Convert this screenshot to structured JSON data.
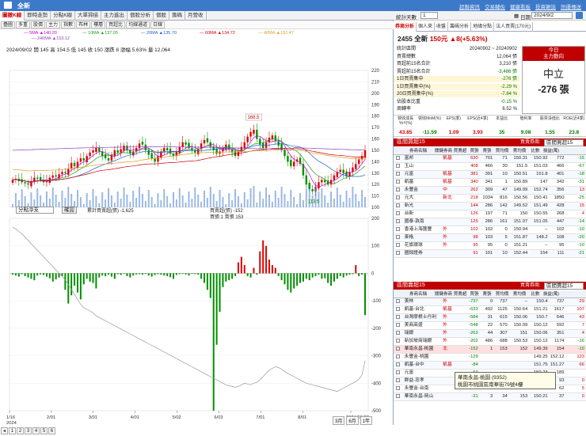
{
  "window": {
    "title": "全新",
    "links": [
      "超聯資訊",
      "交易輔佐",
      "健康看板",
      "投資雜誌",
      "訊優傳送"
    ]
  },
  "left_tabs": [
    "圖撤K線",
    "即時走勢",
    "分點K線",
    "大單掃描",
    "主力進出",
    "個股分析",
    "個股",
    "籌碼",
    "月營收"
  ],
  "left_tabs_active": 0,
  "toolbar": [
    "疊圖",
    "多重",
    "股價",
    "主力",
    "指數",
    "布林",
    "樓層",
    "買超比",
    "均線通道",
    "日線"
  ],
  "ma_legend": [
    {
      "label": "5MA",
      "value": "140.20",
      "color": "#d000d0"
    },
    {
      "label": "10MA",
      "value": "137.05",
      "color": "#20a020"
    },
    {
      "label": "20MA",
      "value": "135.70",
      "color": "#2060d0"
    },
    {
      "label": "60MA",
      "value": "134.72",
      "color": "#d00000"
    },
    {
      "label": "40MA",
      "value": "152.47",
      "color": "#e0a020"
    },
    {
      "label": "240MA",
      "value": "153.12",
      "color": "#9040c0"
    }
  ],
  "ohlc_line": "2024/09/02  開 145  高 154.5  低 145  收 150  漲跌 8  漲幅 5.63%  量 12,064",
  "highlight_labels": {
    "high": "168.5",
    "low": "113.5"
  },
  "price_axis": [
    "220",
    "210",
    "200",
    "190",
    "180",
    "170",
    "160",
    "150",
    "140",
    "130",
    "120",
    "110",
    "100"
  ],
  "sub_controls": {
    "select": "分點淨支",
    "button": "確認"
  },
  "sub_legend": [
    "累計買賣超(張) -1,625",
    "買賣超(張) -152",
    "買張:1 賣張 153"
  ],
  "sub_axis": [
    "200",
    "100",
    "0",
    "-100",
    "-200",
    "-300",
    "-400",
    "-500"
  ],
  "date_axis": [
    "1/16\n2024",
    "2/01",
    "3/01",
    "4/01",
    "5/02",
    "6/03",
    "7/01",
    "8/01",
    "2024/09/02"
  ],
  "range_buttons": [
    "3月",
    "6月",
    "1年"
  ],
  "pager": [
    "1",
    "2",
    "3",
    "4",
    "5",
    "6"
  ],
  "right_top": {
    "label": "統計天數",
    "days": "1",
    "date_label": "日期",
    "date": "2024/9/2"
  },
  "right_tabs": [
    "券商分析",
    "個人來",
    "收盤",
    "籌碼分析",
    "地緣分點",
    "法人買賣(170元)"
  ],
  "stock": {
    "code": "2455",
    "name": "全新",
    "price": "150元",
    "change": "▲8(+5.63%)"
  },
  "stats": [
    {
      "k": "統計區間",
      "v": "20240902 ~ 20240902"
    },
    {
      "k": "買賣總數",
      "v": "12,064 張"
    },
    {
      "k": "買超前15名合計",
      "v": "3,210 張"
    },
    {
      "k": "賣超前15名合計",
      "v": "-3,486 張"
    },
    {
      "k": "1日買賣集中",
      "v": "-276 張"
    },
    {
      "k": "1日買賣集中(%)",
      "v": "-2.29 %"
    },
    {
      "k": "20日買賣集中(%)",
      "v": "-7.84 %"
    },
    {
      "k": "佔股本比重",
      "v": "-0.15 %"
    },
    {
      "k": "周轉率",
      "v": "6.52 %"
    }
  ],
  "market": {
    "title1": "今日",
    "title2": "主力動向",
    "state": "中立",
    "value": "-276 張"
  },
  "fund_head": [
    "營收成長YoY(%)",
    "營收MoM(%)",
    "EPS(季)",
    "EPS(近4季)",
    "本益比",
    "殖利率",
    "股票淨值比",
    "ROE(近4季)"
  ],
  "fund_vals": [
    "43.85",
    "-11.59",
    "1.09",
    "3.93",
    "35",
    "9.08",
    "1.55",
    "23.8"
  ],
  "buy_section": {
    "title": "區間買超15",
    "filter_label": "買賣券商:",
    "filter_value": "區間買超15"
  },
  "sell_section": {
    "title": "區間賣超15",
    "filter_label": "買賣券商:",
    "filter_value": "區間賣超15"
  },
  "table_cols": [
    "",
    "券商名稱",
    "關鍵券商",
    "買賣超",
    "買張",
    "賣張",
    "買均價",
    "賣均價",
    "比數",
    "損益(萬)"
  ],
  "buy_rows": [
    [
      "富邦",
      "凱基",
      "630",
      "701",
      "71",
      "150.31",
      "150.92",
      "772",
      "-15"
    ],
    [
      "玉山",
      "",
      "408",
      "466",
      "30",
      "151.5",
      "151.03",
      "466",
      "-67"
    ],
    [
      "元富",
      "凱基",
      "381",
      "391",
      "10",
      "150.51",
      "151.8",
      "401",
      "-18"
    ],
    [
      "凱基",
      "凱基",
      "340",
      "341",
      "1",
      "150.89",
      "147",
      "342",
      "-31"
    ],
    [
      "永豐金",
      "中",
      "262",
      "309",
      "47",
      "149.99",
      "152.74",
      "356",
      "13"
    ],
    [
      "元大",
      "新北",
      "218",
      "1034",
      "816",
      "150.56",
      "150.41",
      "1850",
      "-25"
    ],
    [
      "新光",
      "",
      "144",
      "286",
      "142",
      "149.52",
      "151.49",
      "428",
      "15"
    ],
    [
      "台新",
      "",
      "126",
      "197",
      "71",
      "150",
      "150.55",
      "268",
      "4"
    ],
    [
      "國泰-敦南",
      "",
      "125",
      "286",
      "161",
      "151.07",
      "151.05",
      "447",
      "-14"
    ],
    [
      "香港上海匯豐",
      "外",
      "102",
      "102",
      "0",
      "150.94",
      "--",
      "102",
      "-10"
    ],
    [
      "麥格",
      "外",
      "98",
      "103",
      "5",
      "151.87",
      "148.2",
      "108",
      "-20"
    ],
    [
      "花旗環球",
      "外",
      "95",
      "95",
      "0",
      "151.21",
      "--",
      "95",
      "-10"
    ],
    [
      "國錢證券",
      "",
      "91",
      "101",
      "10",
      "152.44",
      "154",
      "111",
      "-21"
    ]
  ],
  "sell_rows": [
    [
      "美林",
      "外",
      "-737",
      "0",
      "737",
      "--",
      "150.4",
      "737",
      "29"
    ],
    [
      "凱基-台北",
      "凱基",
      "-633",
      "492",
      "1125",
      "150.64",
      "151.21",
      "1617",
      "107"
    ],
    [
      "台灣摩根士丹利",
      "外",
      "-584",
      "31",
      "615",
      "150.06",
      "150.7",
      "646",
      "43"
    ],
    [
      "美商高盛",
      "外",
      "-548",
      "22",
      "570",
      "150.09",
      "150.12",
      "592",
      "7"
    ],
    [
      "瑞銀",
      "外",
      "-263",
      "44",
      "307",
      "151",
      "150.06",
      "351",
      "4"
    ],
    [
      "新加坡商瑞銀",
      "外",
      "-202",
      "486",
      "688",
      "150.53",
      "150.12",
      "1174",
      "-16"
    ],
    [
      "華南永昌-桃園",
      "北",
      "-152",
      "1",
      "153",
      "152",
      "149.39",
      "154",
      "-10"
    ],
    [
      "永豐金-桃園",
      "",
      "-129",
      "",
      "",
      "",
      "149.25",
      "152.12",
      "123"
    ],
    [
      "凱基-台中",
      "凱基",
      "-84",
      "",
      "",
      "",
      "151.75",
      "151.27",
      "66"
    ],
    [
      "元富",
      "",
      "-60",
      "",
      "",
      "",
      "150.23",
      "189",
      ""
    ],
    [
      "群益-忠孝",
      "",
      "-37",
      "28",
      "65",
      "150.04",
      "151.6",
      "93",
      "0"
    ],
    [
      "永豐金-台南",
      "",
      "-34",
      "14",
      "48",
      "150.5",
      "151.21",
      "62",
      "5"
    ],
    [
      "華南永昌-岡山",
      "",
      "-31",
      "3",
      "34",
      "153",
      "150.21",
      "37",
      "0"
    ]
  ],
  "tooltip": {
    "line1": "華南永昌-桃園 (9352)",
    "line2": "桃園市桃園區南華街79號4樓"
  },
  "chart_data": [
    {
      "type": "candlestick",
      "title": "",
      "ylim": [
        100,
        220
      ],
      "annotations": [
        {
          "text": "168.5",
          "at": "peak"
        },
        {
          "text": "113.5",
          "at": "trough"
        }
      ],
      "close_series": [
        124,
        125,
        123,
        122,
        121,
        120,
        123,
        126,
        125,
        124,
        122,
        123,
        126,
        128,
        127,
        129,
        131,
        130,
        134,
        139,
        136,
        140,
        143,
        141,
        145,
        148,
        150,
        152,
        149,
        145,
        143,
        141,
        146,
        150,
        148,
        151,
        154,
        150,
        147,
        149,
        152,
        156,
        155,
        150,
        146,
        143,
        140,
        145,
        149,
        152,
        150,
        147,
        145,
        149,
        153,
        157,
        155,
        152,
        150,
        148,
        151,
        156,
        159,
        157,
        153,
        150,
        147,
        149,
        152,
        155,
        151,
        148,
        145,
        149,
        153,
        157,
        162,
        166,
        168,
        160,
        155,
        152,
        157,
        161,
        163,
        158,
        154,
        150,
        145,
        140,
        136,
        140,
        142,
        138,
        128,
        120,
        116,
        114,
        118,
        122,
        124,
        122,
        120,
        124,
        128,
        131,
        133,
        130,
        127,
        131,
        135,
        138,
        142,
        145,
        150
      ]
    },
    {
      "type": "bar",
      "title": "",
      "ylim": [
        -500,
        200
      ],
      "series": [
        {
          "name": "買賣超(張)",
          "values": [
            -5,
            -8,
            -12,
            -3,
            -10,
            -15,
            -20,
            -25,
            -8,
            -4,
            -6,
            -12,
            -18,
            -30,
            -22,
            -15,
            -10,
            -60,
            -110,
            -80,
            -45,
            -70,
            -95,
            -40,
            -20,
            -30,
            -35,
            -55,
            -15,
            -8,
            -10,
            -5,
            -12,
            -20,
            -3,
            -6,
            -2,
            -10,
            -15,
            -8,
            -4,
            -3,
            -5,
            -2,
            -8,
            -12,
            -6,
            -3,
            -5,
            -8,
            -10,
            -14,
            -20,
            -6,
            -3,
            -2,
            -4,
            -8,
            -2,
            -3,
            -5,
            -20,
            -35,
            -60,
            -90,
            -500,
            -260,
            -140,
            -50,
            -30,
            -25,
            -20,
            -10,
            40,
            60,
            30,
            -10,
            -15,
            20,
            -5,
            80,
            120,
            100,
            50,
            30,
            20,
            -10,
            -25,
            -40,
            -60,
            -70,
            -55,
            -45,
            -35,
            -30,
            -20,
            -25,
            -15,
            -10,
            -5,
            -20,
            -18,
            -35,
            -45,
            -30,
            -20,
            -10,
            -15,
            -8,
            -5,
            -3,
            30,
            -10,
            -5,
            -152
          ]
        },
        {
          "name": "累計買賣超(張)",
          "values": [
            0,
            -20,
            -50,
            -80,
            -120,
            -160,
            -200,
            -240,
            -280,
            -320,
            -360,
            -400,
            -440,
            -480,
            -520,
            -560,
            -600,
            -640,
            -700,
            -760,
            -820,
            -880,
            -940,
            -980,
            -1000,
            -1020,
            -1040,
            -1080,
            -1100,
            -1120,
            -1140,
            -1160,
            -1180,
            -1200,
            -1220,
            -1240,
            -1260,
            -1280,
            -1300,
            -1320,
            -1340,
            -1360,
            -1380,
            -1400,
            -1420,
            -1440,
            -1460,
            -1480,
            -1500,
            -1520,
            -1540,
            -1560,
            -1580,
            -1600,
            -1620,
            -1640,
            -1660,
            -1680,
            -1700,
            -1720,
            -1740,
            -1760,
            -1780,
            -1800,
            -1820,
            -1840,
            -1860,
            -1880,
            -1900,
            -1920,
            -1930,
            -1940,
            -1950,
            -1940,
            -1920,
            -1900,
            -1910,
            -1920,
            -1900,
            -1890,
            -1860,
            -1820,
            -1780,
            -1740,
            -1720,
            -1700,
            -1710,
            -1730,
            -1760,
            -1780,
            -1800,
            -1820,
            -1840,
            -1860,
            -1880,
            -1900,
            -1910,
            -1920,
            -1930,
            -1940,
            -1950,
            -1960,
            -1970,
            -1980,
            -1990,
            -2000,
            -1980,
            -1960,
            -1940,
            -1920,
            -1900,
            -1880,
            -1850,
            -1800,
            -1625
          ]
        }
      ]
    }
  ]
}
